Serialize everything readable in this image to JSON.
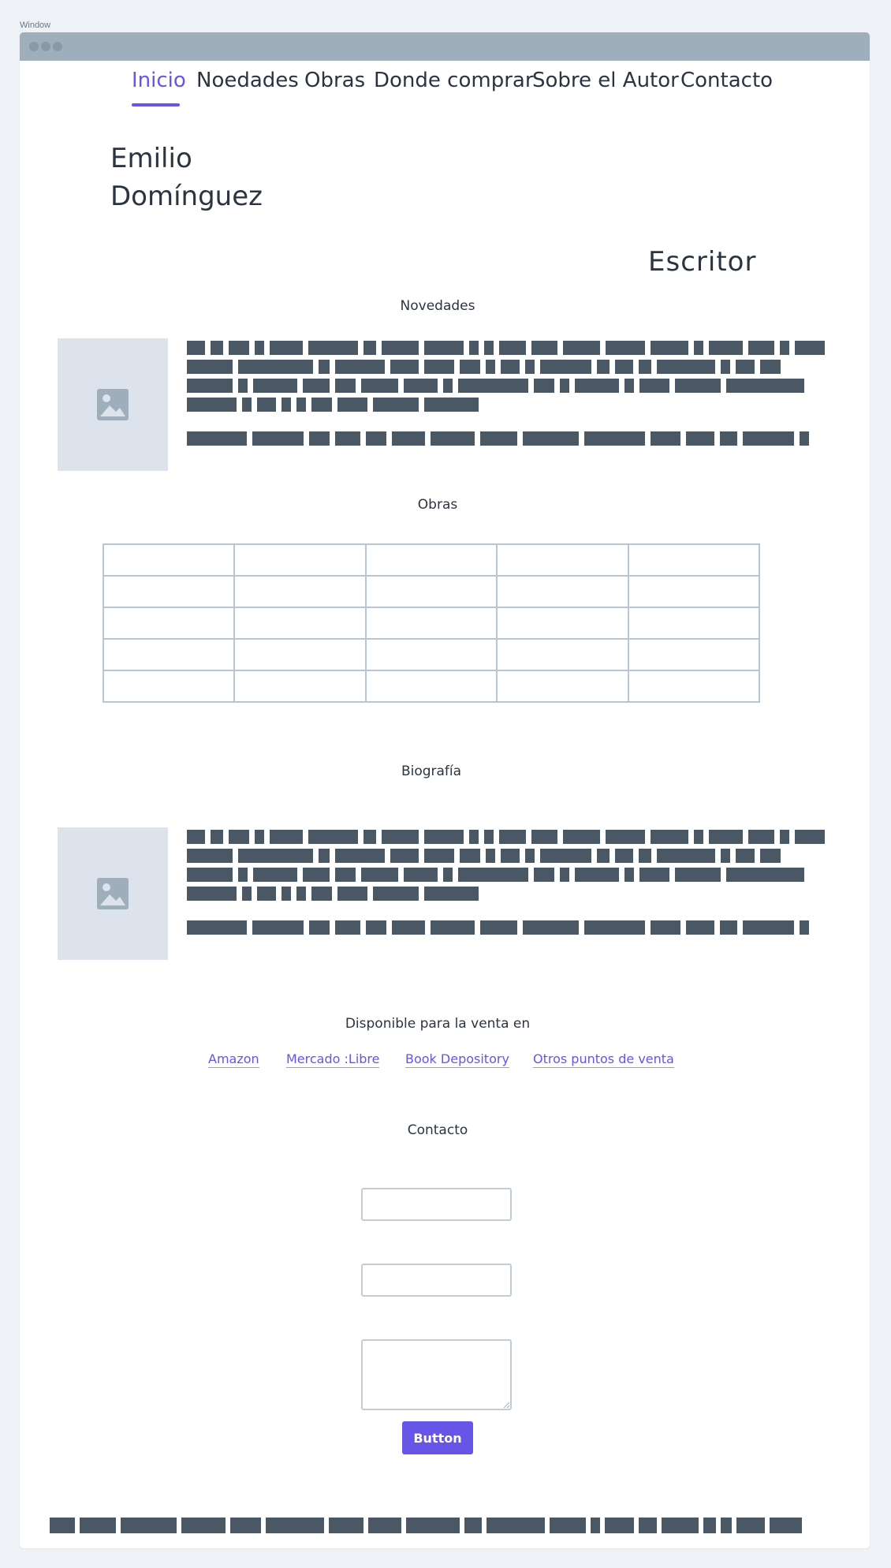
{
  "window": {
    "label": "Window"
  },
  "nav": {
    "items": [
      {
        "label": "Inicio",
        "active": true
      },
      {
        "label": "Noedades"
      },
      {
        "label": "Obras"
      },
      {
        "label": "Donde comprar"
      },
      {
        "label": "Sobre el Autor"
      },
      {
        "label": "Contacto"
      }
    ]
  },
  "header": {
    "name_line1": "Emilio",
    "name_line2": "Domínguez",
    "tagline": "Escritor"
  },
  "sections": {
    "novedades": {
      "title": "Novedades"
    },
    "obras": {
      "title": "Obras",
      "table_rows": 5,
      "table_cols": 5
    },
    "biografia": {
      "title": "Biografía"
    },
    "venta": {
      "title": "Disponible para la venta en",
      "links": [
        "Amazon",
        "Mercado :Libre",
        "Book Depository",
        "Otros puntos de venta"
      ]
    },
    "contacto": {
      "title": "Contacto",
      "button_label": "Button"
    }
  },
  "colors": {
    "accent": "#6655e6",
    "text": "#2b3441",
    "placeholder_block": "#4a5866",
    "image_bg": "#dde3ec",
    "titlebar": "#9eaeba"
  },
  "icons": {
    "placeholder": "image-placeholder-icon"
  }
}
